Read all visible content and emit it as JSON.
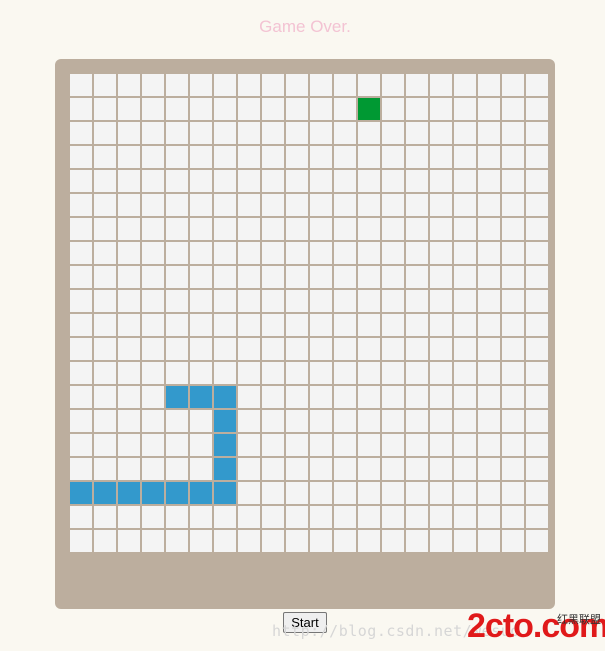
{
  "game": {
    "status": "Game Over.",
    "grid_cols": 20,
    "grid_rows": 20,
    "snake_cells": [
      [
        4,
        13
      ],
      [
        5,
        13
      ],
      [
        6,
        13
      ],
      [
        6,
        14
      ],
      [
        6,
        15
      ],
      [
        6,
        16
      ],
      [
        6,
        17
      ],
      [
        5,
        17
      ],
      [
        4,
        17
      ],
      [
        3,
        17
      ],
      [
        2,
        17
      ],
      [
        1,
        17
      ],
      [
        0,
        17
      ]
    ],
    "food_cell": [
      12,
      1
    ]
  },
  "controls": {
    "start_label": "Start"
  },
  "watermark": {
    "url": "http://blog.csdn.net/wesuo",
    "logo_text": "2cto.com",
    "logo_sub": "红黑联盟"
  },
  "colors": {
    "background": "#faf8f1",
    "board": "#bcae9e",
    "cell": "#f4f4f4",
    "snake": "#3399cc",
    "food": "#009933",
    "status_text": "#f3c3d3",
    "logo": "#e0191a"
  }
}
